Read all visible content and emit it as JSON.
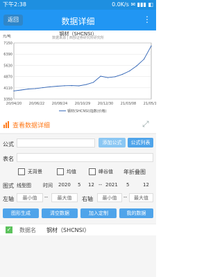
{
  "status": {
    "time": "下午2:38",
    "right": "0.0K/s  ✉  ▮▮▮  ◧"
  },
  "header": {
    "back_label": "返回",
    "title": "数据详细",
    "more": "⋮"
  },
  "chart": {
    "title": "钢材（SHCNSI）",
    "subtitle": "数据来源 | 西部证券研究所研究所",
    "unit": "元/吨",
    "y_ticks": [
      "7150",
      "6390",
      "5630",
      "4870",
      "4110",
      "3350"
    ],
    "x_ticks": [
      "20/04/20",
      "20/06/22",
      "20/08/24",
      "20/10/29",
      "20/12/30",
      "21/03/08",
      "21/05/11"
    ],
    "legend": "钢材(SHCNSI)指数(价格)"
  },
  "chart_data": {
    "type": "line",
    "title": "钢材（SHCNSI）",
    "xlabel": "",
    "ylabel": "元/吨",
    "ylim": [
      3350,
      7150
    ],
    "x": [
      "20/04/20",
      "20/05/10",
      "20/06/01",
      "20/06/22",
      "20/07/15",
      "20/08/05",
      "20/08/24",
      "20/09/15",
      "20/10/10",
      "20/10/29",
      "20/11/20",
      "20/12/10",
      "20/12/30",
      "21/01/20",
      "21/02/10",
      "21/03/08",
      "21/03/30",
      "21/04/20",
      "21/05/01",
      "21/05/11"
    ],
    "series": [
      {
        "name": "钢材(SHCNSI)指数(价格)",
        "values": [
          3900,
          3960,
          4030,
          4060,
          4120,
          4180,
          4220,
          4250,
          4260,
          4240,
          4330,
          4480,
          4900,
          4800,
          4860,
          5020,
          5250,
          5600,
          6050,
          6950
        ]
      }
    ]
  },
  "tools": {
    "label": "查看数据详细"
  },
  "form": {
    "formula_label": "公式",
    "add_formula": "添加公式",
    "formula_list": "公式列表",
    "sheet_label": "表名",
    "no_bg": "无背景",
    "mean": "均值",
    "peak": "峰谷值",
    "year_fold": "年折叠图",
    "chart_style_label": "图式",
    "chart_style_value": "线型图",
    "time_label": "时间",
    "start_year": "2020",
    "start_month": "5",
    "start_day": "12",
    "dash": "--",
    "end_year": "2021",
    "end_month": "5",
    "end_day": "12",
    "left_axis": "左轴",
    "right_axis": "右轴",
    "min": "最小值",
    "max": "最大值",
    "generate": "图形生成",
    "clear": "清空数据",
    "add_custom": "加入定制",
    "my_data": "我的数据"
  },
  "list": {
    "name_label": "数据名",
    "value": "钢材（SHCNSI）"
  }
}
